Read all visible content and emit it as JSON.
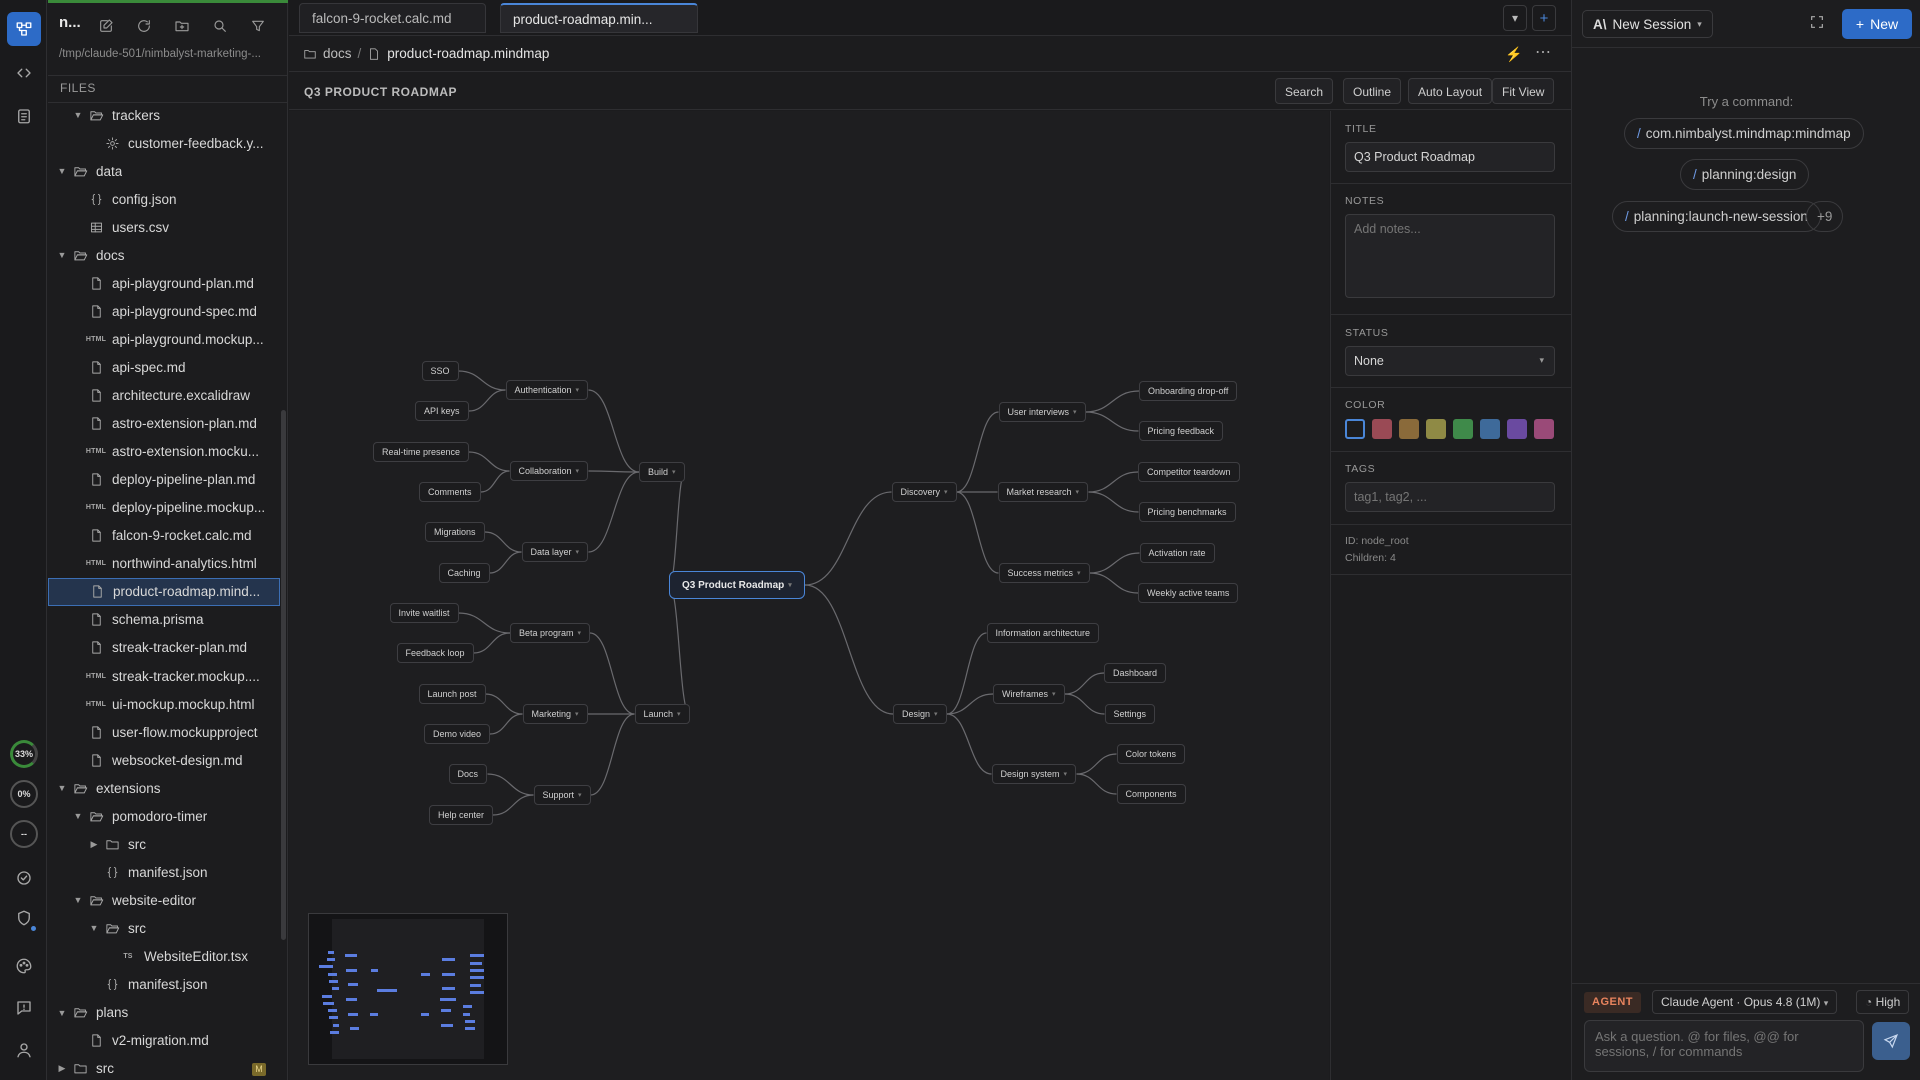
{
  "rail": {
    "icons": [
      "app-logo-icon",
      "code-icon",
      "clipboard-icon"
    ],
    "usage": [
      "33%",
      "0%",
      "--"
    ],
    "bottom_icons": [
      "check-circle-icon",
      "shield-icon",
      "palette-icon",
      "feedback-icon",
      "user-icon"
    ]
  },
  "sidebar": {
    "title": "n...",
    "path": "/tmp/claude-501/nimbalyst-marketing-...",
    "files_header": "FILES",
    "tree": [
      {
        "depth": 1,
        "kind": "folder",
        "open": true,
        "name": "trackers"
      },
      {
        "depth": 2,
        "kind": "gear",
        "name": "customer-feedback.y..."
      },
      {
        "depth": 0,
        "kind": "folder",
        "open": true,
        "name": "data"
      },
      {
        "depth": 1,
        "kind": "json",
        "name": "config.json"
      },
      {
        "depth": 1,
        "kind": "table",
        "name": "users.csv"
      },
      {
        "depth": 0,
        "kind": "folder",
        "open": true,
        "name": "docs"
      },
      {
        "depth": 1,
        "kind": "doc",
        "name": "api-playground-plan.md"
      },
      {
        "depth": 1,
        "kind": "doc",
        "name": "api-playground-spec.md"
      },
      {
        "depth": 1,
        "kind": "html",
        "name": "api-playground.mockup..."
      },
      {
        "depth": 1,
        "kind": "doc",
        "name": "api-spec.md"
      },
      {
        "depth": 1,
        "kind": "doc",
        "name": "architecture.excalidraw"
      },
      {
        "depth": 1,
        "kind": "doc",
        "name": "astro-extension-plan.md"
      },
      {
        "depth": 1,
        "kind": "html",
        "name": "astro-extension.mocku..."
      },
      {
        "depth": 1,
        "kind": "doc",
        "name": "deploy-pipeline-plan.md"
      },
      {
        "depth": 1,
        "kind": "html",
        "name": "deploy-pipeline.mockup..."
      },
      {
        "depth": 1,
        "kind": "doc",
        "name": "falcon-9-rocket.calc.md"
      },
      {
        "depth": 1,
        "kind": "html",
        "name": "northwind-analytics.html"
      },
      {
        "depth": 1,
        "kind": "doc",
        "name": "product-roadmap.mind...",
        "selected": true
      },
      {
        "depth": 1,
        "kind": "doc",
        "name": "schema.prisma"
      },
      {
        "depth": 1,
        "kind": "doc",
        "name": "streak-tracker-plan.md"
      },
      {
        "depth": 1,
        "kind": "html",
        "name": "streak-tracker.mockup...."
      },
      {
        "depth": 1,
        "kind": "html",
        "name": "ui-mockup.mockup.html"
      },
      {
        "depth": 1,
        "kind": "doc",
        "name": "user-flow.mockupproject"
      },
      {
        "depth": 1,
        "kind": "doc",
        "name": "websocket-design.md"
      },
      {
        "depth": 0,
        "kind": "folder",
        "open": true,
        "name": "extensions"
      },
      {
        "depth": 1,
        "kind": "folder",
        "open": true,
        "name": "pomodoro-timer"
      },
      {
        "depth": 2,
        "kind": "folder",
        "open": false,
        "name": "src"
      },
      {
        "depth": 2,
        "kind": "json",
        "name": "manifest.json"
      },
      {
        "depth": 1,
        "kind": "folder",
        "open": true,
        "name": "website-editor"
      },
      {
        "depth": 2,
        "kind": "folder",
        "open": true,
        "name": "src"
      },
      {
        "depth": 3,
        "kind": "ts",
        "name": "WebsiteEditor.tsx"
      },
      {
        "depth": 2,
        "kind": "json",
        "name": "manifest.json"
      },
      {
        "depth": 0,
        "kind": "folder",
        "open": true,
        "name": "plans"
      },
      {
        "depth": 1,
        "kind": "doc",
        "name": "v2-migration.md"
      },
      {
        "depth": 0,
        "kind": "folder",
        "open": false,
        "name": "src",
        "badge": "M"
      }
    ]
  },
  "editor": {
    "tabs": [
      "falcon-9-rocket.calc.md",
      "product-roadmap.min..."
    ],
    "active_tab": 1,
    "breadcrumb": {
      "folder": "docs",
      "sep": "/",
      "file": "product-roadmap.mindmap"
    },
    "mindmap_title": "Q3 PRODUCT ROADMAP",
    "toolbar": [
      "Search",
      "Outline",
      "Auto Layout",
      "Fit View"
    ]
  },
  "mindmap": {
    "root": "Q3 Product Roadmap",
    "nodes": [
      {
        "id": "build",
        "label": "Build",
        "parent": "root"
      },
      {
        "id": "auth",
        "label": "Authentication",
        "parent": "build"
      },
      {
        "id": "sso",
        "label": "SSO",
        "parent": "auth"
      },
      {
        "id": "apik",
        "label": "API keys",
        "parent": "auth"
      },
      {
        "id": "collab",
        "label": "Collaboration",
        "parent": "build"
      },
      {
        "id": "rtp",
        "label": "Real-time presence",
        "parent": "collab"
      },
      {
        "id": "comm",
        "label": "Comments",
        "parent": "collab"
      },
      {
        "id": "dl",
        "label": "Data layer",
        "parent": "build"
      },
      {
        "id": "mig",
        "label": "Migrations",
        "parent": "dl"
      },
      {
        "id": "cach",
        "label": "Caching",
        "parent": "dl"
      },
      {
        "id": "launch",
        "label": "Launch",
        "parent": "root"
      },
      {
        "id": "beta",
        "label": "Beta program",
        "parent": "launch"
      },
      {
        "id": "inv",
        "label": "Invite waitlist",
        "parent": "beta"
      },
      {
        "id": "fb",
        "label": "Feedback loop",
        "parent": "beta"
      },
      {
        "id": "mkt",
        "label": "Marketing",
        "parent": "launch"
      },
      {
        "id": "lp",
        "label": "Launch post",
        "parent": "mkt"
      },
      {
        "id": "dv",
        "label": "Demo video",
        "parent": "mkt"
      },
      {
        "id": "sup",
        "label": "Support",
        "parent": "launch"
      },
      {
        "id": "docs",
        "label": "Docs",
        "parent": "sup"
      },
      {
        "id": "hc",
        "label": "Help center",
        "parent": "sup"
      },
      {
        "id": "disc",
        "label": "Discovery",
        "parent": "root"
      },
      {
        "id": "ui",
        "label": "User interviews",
        "parent": "disc"
      },
      {
        "id": "odo",
        "label": "Onboarding drop-off",
        "parent": "ui"
      },
      {
        "id": "pf",
        "label": "Pricing feedback",
        "parent": "ui"
      },
      {
        "id": "mr",
        "label": "Market research",
        "parent": "disc"
      },
      {
        "id": "ct",
        "label": "Competitor teardown",
        "parent": "mr"
      },
      {
        "id": "pb",
        "label": "Pricing benchmarks",
        "parent": "mr"
      },
      {
        "id": "sm",
        "label": "Success metrics",
        "parent": "disc"
      },
      {
        "id": "ar",
        "label": "Activation rate",
        "parent": "sm"
      },
      {
        "id": "wat",
        "label": "Weekly active teams",
        "parent": "sm"
      },
      {
        "id": "design",
        "label": "Design",
        "parent": "root"
      },
      {
        "id": "ia",
        "label": "Information architecture",
        "parent": "design"
      },
      {
        "id": "wf",
        "label": "Wireframes",
        "parent": "design"
      },
      {
        "id": "dash",
        "label": "Dashboard",
        "parent": "wf"
      },
      {
        "id": "set",
        "label": "Settings",
        "parent": "wf"
      },
      {
        "id": "ds",
        "label": "Design system",
        "parent": "design"
      },
      {
        "id": "tok",
        "label": "Color tokens",
        "parent": "ds"
      },
      {
        "id": "cmp",
        "label": "Components",
        "parent": "ds"
      }
    ]
  },
  "properties": {
    "title_label": "TITLE",
    "title_value": "Q3 Product Roadmap",
    "notes_label": "NOTES",
    "notes_placeholder": "Add notes...",
    "status_label": "STATUS",
    "status_value": "None",
    "color_label": "COLOR",
    "colors": [
      "#1c1c1e",
      "#9a4a55",
      "#8a6a3a",
      "#8f8a45",
      "#3f8a4a",
      "#3e6a9a",
      "#6a4aa0",
      "#9a4a78"
    ],
    "tags_label": "TAGS",
    "tags_placeholder": "tag1, tag2, ...",
    "id_text": "ID: node_root",
    "children_text": "Children: 4"
  },
  "agent": {
    "session_label": "New Session",
    "new_label": "New",
    "try_label": "Try a command:",
    "commands": [
      "com.nimbalyst.mindmap:mindmap",
      "planning:design",
      "planning:launch-new-session"
    ],
    "more_label": "+9",
    "tag": "AGENT",
    "model": "Claude Agent · Opus 4.8 (1M)",
    "effort": "High",
    "input_placeholder": "Ask a question. @ for files, @@ for sessions, / for commands"
  }
}
